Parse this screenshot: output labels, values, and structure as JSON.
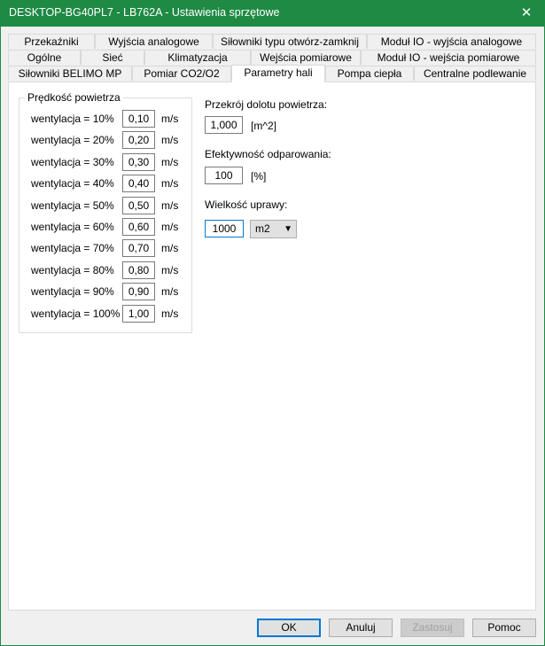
{
  "window": {
    "title": "DESKTOP-BG40PL7 - LB762A - Ustawienia sprzętowe",
    "close_glyph": "✕"
  },
  "tabs": {
    "row1": [
      "Przekaźniki",
      "Wyjścia analogowe",
      "Siłowniki typu otwórz-zamknij",
      "Moduł IO - wyjścia analogowe"
    ],
    "row2": [
      "Ogólne",
      "Sieć",
      "Klimatyzacja",
      "Wejścia pomiarowe",
      "Moduł IO - wejścia pomiarowe"
    ],
    "row3": [
      "Siłowniki BELIMO MP",
      "Pomiar CO2/O2",
      "Parametry hali",
      "Pompa ciepła",
      "Centralne podlewanie"
    ],
    "active": "Parametry hali"
  },
  "air_speed": {
    "title": "Prędkość powietrza",
    "unit": "m/s",
    "rows": [
      {
        "label": "wentylacja = 10%",
        "value": "0,10"
      },
      {
        "label": "wentylacja = 20%",
        "value": "0,20"
      },
      {
        "label": "wentylacja = 30%",
        "value": "0,30"
      },
      {
        "label": "wentylacja = 40%",
        "value": "0,40"
      },
      {
        "label": "wentylacja = 50%",
        "value": "0,50"
      },
      {
        "label": "wentylacja = 60%",
        "value": "0,60"
      },
      {
        "label": "wentylacja = 70%",
        "value": "0,70"
      },
      {
        "label": "wentylacja = 80%",
        "value": "0,80"
      },
      {
        "label": "wentylacja = 90%",
        "value": "0,90"
      },
      {
        "label": "wentylacja = 100%",
        "value": "1,00"
      }
    ]
  },
  "inlet": {
    "label": "Przekrój dolotu powietrza:",
    "value": "1,000",
    "unit": "[m^2]"
  },
  "efficiency": {
    "label": "Efektywność odparowania:",
    "value": "100",
    "unit": "[%]"
  },
  "crop": {
    "label": "Wielkość uprawy:",
    "value": "1000",
    "unit_selected": "m2"
  },
  "buttons": {
    "ok": "OK",
    "cancel": "Anuluj",
    "apply": "Zastosuj",
    "help": "Pomoc"
  }
}
